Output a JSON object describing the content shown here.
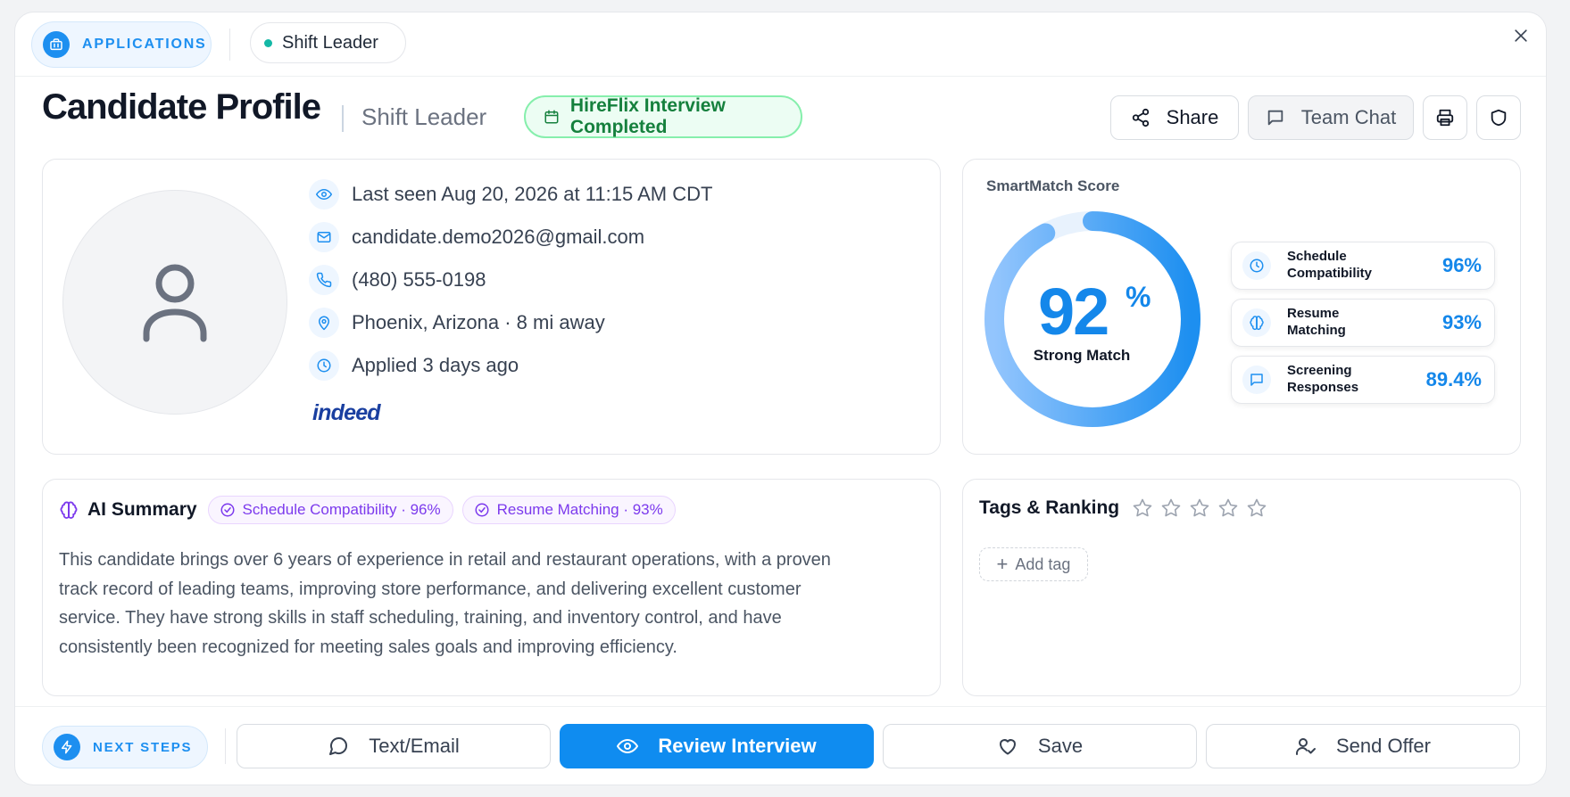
{
  "topbar": {
    "applications_label": "APPLICATIONS",
    "role_label": "Shift Leader",
    "icons": {
      "applications": "briefcase-icon",
      "close": "close-icon"
    }
  },
  "header": {
    "title": "Candidate Profile",
    "subtitle": "Shift Leader",
    "status": "HireFlix Interview Completed",
    "share_label": "Share",
    "team_chat_label": "Team Chat",
    "icons": {
      "status": "calendar-icon",
      "share": "share-icon",
      "team_chat": "chat-icon",
      "print": "printer-icon",
      "shield": "shield-icon"
    }
  },
  "profile": {
    "avatar_icon": "user-icon",
    "last_seen": "Last seen Aug 20, 2026 at 11:15 AM CDT",
    "email": "candidate.demo2026@gmail.com",
    "phone": "(480) 555-0198",
    "location": "Phoenix, Arizona · 8 mi away",
    "applied": "Applied 3 days ago",
    "source": "indeed"
  },
  "smartmatch": {
    "label": "SmartMatch Score",
    "score": "92",
    "score_value": 92,
    "percent_sign": "%",
    "verdict": "Strong Match",
    "metrics": [
      {
        "label_line1": "Schedule",
        "label_line2": "Compatibility",
        "value": "96%",
        "icon": "clock-icon"
      },
      {
        "label_line1": "Resume",
        "label_line2": "Matching",
        "value": "93%",
        "icon": "brain-icon"
      },
      {
        "label_line1": "Screening",
        "label_line2": "Responses",
        "value": "89.4%",
        "icon": "message-icon"
      }
    ],
    "colors": {
      "accent": "#1487ea",
      "ring_light": "#93c5fd"
    }
  },
  "ai_summary": {
    "title": "AI Summary",
    "chips": [
      "Schedule Compatibility · 96%",
      "Resume Matching · 93%"
    ],
    "text": "This candidate brings over 6 years of experience in retail and restaurant operations, with a proven track record of leading teams, improving store performance, and delivering excellent customer service. They have strong skills in staff scheduling, training, and inventory control, and have consistently been recognized for meeting sales goals and improving efficiency."
  },
  "tags": {
    "title": "Tags & Ranking",
    "rating_filled": 0,
    "rating_max": 5,
    "add_tag_label": "Add tag"
  },
  "bottom": {
    "next_steps_label": "NEXT STEPS",
    "actions": [
      {
        "label": "Text/Email",
        "icon": "chat-icon"
      },
      {
        "label": "Review Interview",
        "icon": "eye-icon"
      },
      {
        "label": "Save",
        "icon": "heart-icon"
      },
      {
        "label": "Send Offer",
        "icon": "user-check-icon"
      }
    ]
  }
}
